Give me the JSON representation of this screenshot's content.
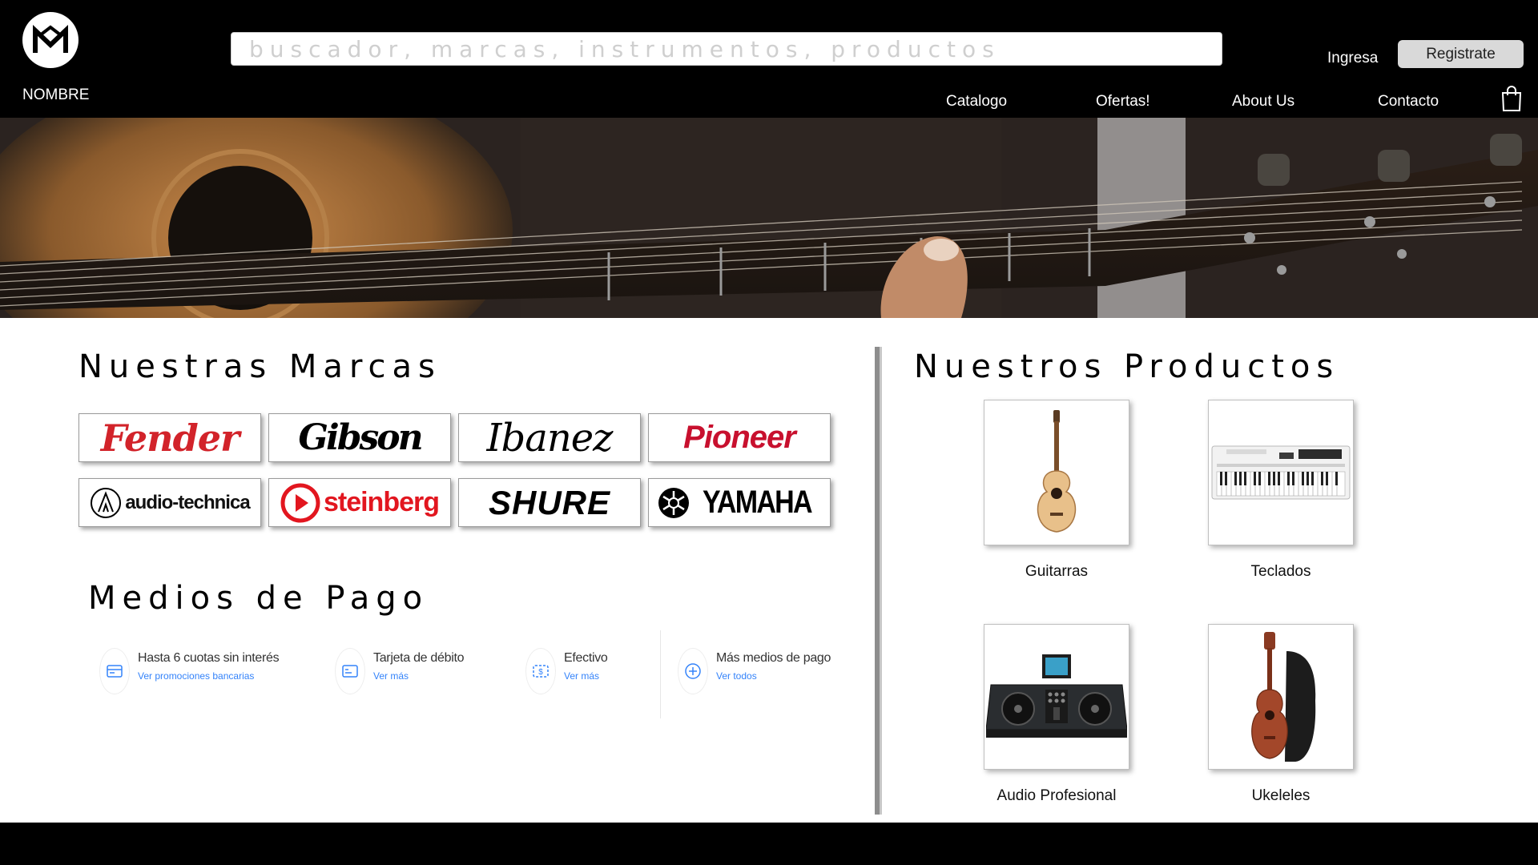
{
  "header": {
    "brand_name": "NOMBRE",
    "search_placeholder": "buscador, marcas, instrumentos, productos",
    "login_label": "Ingresa",
    "register_label": "Registrate",
    "nav": [
      "Catalogo",
      "Ofertas!",
      "About Us",
      "Contacto"
    ]
  },
  "brands": {
    "title": "Nuestras Marcas",
    "items": [
      "Fender",
      "Gibson",
      "Ibanez",
      "Pioneer",
      "audio-technica",
      "steinberg",
      "SHURE",
      "YAMAHA"
    ]
  },
  "payments": {
    "title": "Medios de Pago",
    "items": [
      {
        "title": "Hasta 6 cuotas sin interés",
        "link": "Ver promociones bancarias"
      },
      {
        "title": "Tarjeta de débito",
        "link": "Ver más"
      },
      {
        "title": "Efectivo",
        "link": "Ver más"
      },
      {
        "title": "Más medios de pago",
        "link": "Ver todos"
      }
    ]
  },
  "products": {
    "title": "Nuestros Productos",
    "items": [
      "Guitarras",
      "Teclados",
      "Audio Profesional",
      "Ukeleles"
    ]
  },
  "colors": {
    "header_bg": "#000000",
    "accent_link": "#3483fa",
    "fender_red": "#d2232a",
    "pioneer_red": "#c8102e",
    "steinberg_red": "#e2161f"
  }
}
